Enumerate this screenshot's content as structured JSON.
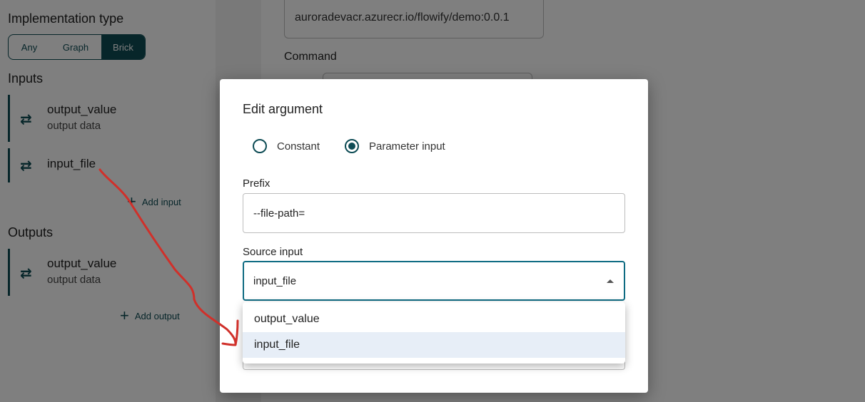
{
  "left": {
    "implementation_type_label": "Implementation type",
    "toggle": [
      {
        "label": "Any",
        "active": false
      },
      {
        "label": "Graph",
        "active": false
      },
      {
        "label": "Brick",
        "active": true
      }
    ],
    "inputs_label": "Inputs",
    "inputs": [
      {
        "name": "output_value",
        "description": "output data"
      },
      {
        "name": "input_file",
        "description": ""
      }
    ],
    "add_input_label": "Add input",
    "outputs_label": "Outputs",
    "outputs": [
      {
        "name": "output_value",
        "description": "output data"
      }
    ],
    "add_output_label": "Add output"
  },
  "right": {
    "image_value": "auroradevacr.azurecr.io/flowify/demo:0.0.1",
    "command_label": "Command"
  },
  "dialog": {
    "title": "Edit argument",
    "radio_options": [
      {
        "label": "Constant",
        "checked": false
      },
      {
        "label": "Parameter input",
        "checked": true
      }
    ],
    "prefix_label": "Prefix",
    "prefix_value": "--file-path=",
    "source_input_label": "Source input",
    "source_input_value": "input_file",
    "menu_options": [
      {
        "label": "output_value",
        "selected": false
      },
      {
        "label": "input_file",
        "selected": true
      }
    ]
  },
  "icons": {
    "swap": "swap-horiz-icon",
    "add": "plus-icon",
    "dropdown": "arrow-drop-up-icon"
  },
  "colors": {
    "accent": "#0e4c55",
    "focus": "#0e6b82",
    "annotation": "#d0302a",
    "menu_selected": "#e7eef7"
  }
}
